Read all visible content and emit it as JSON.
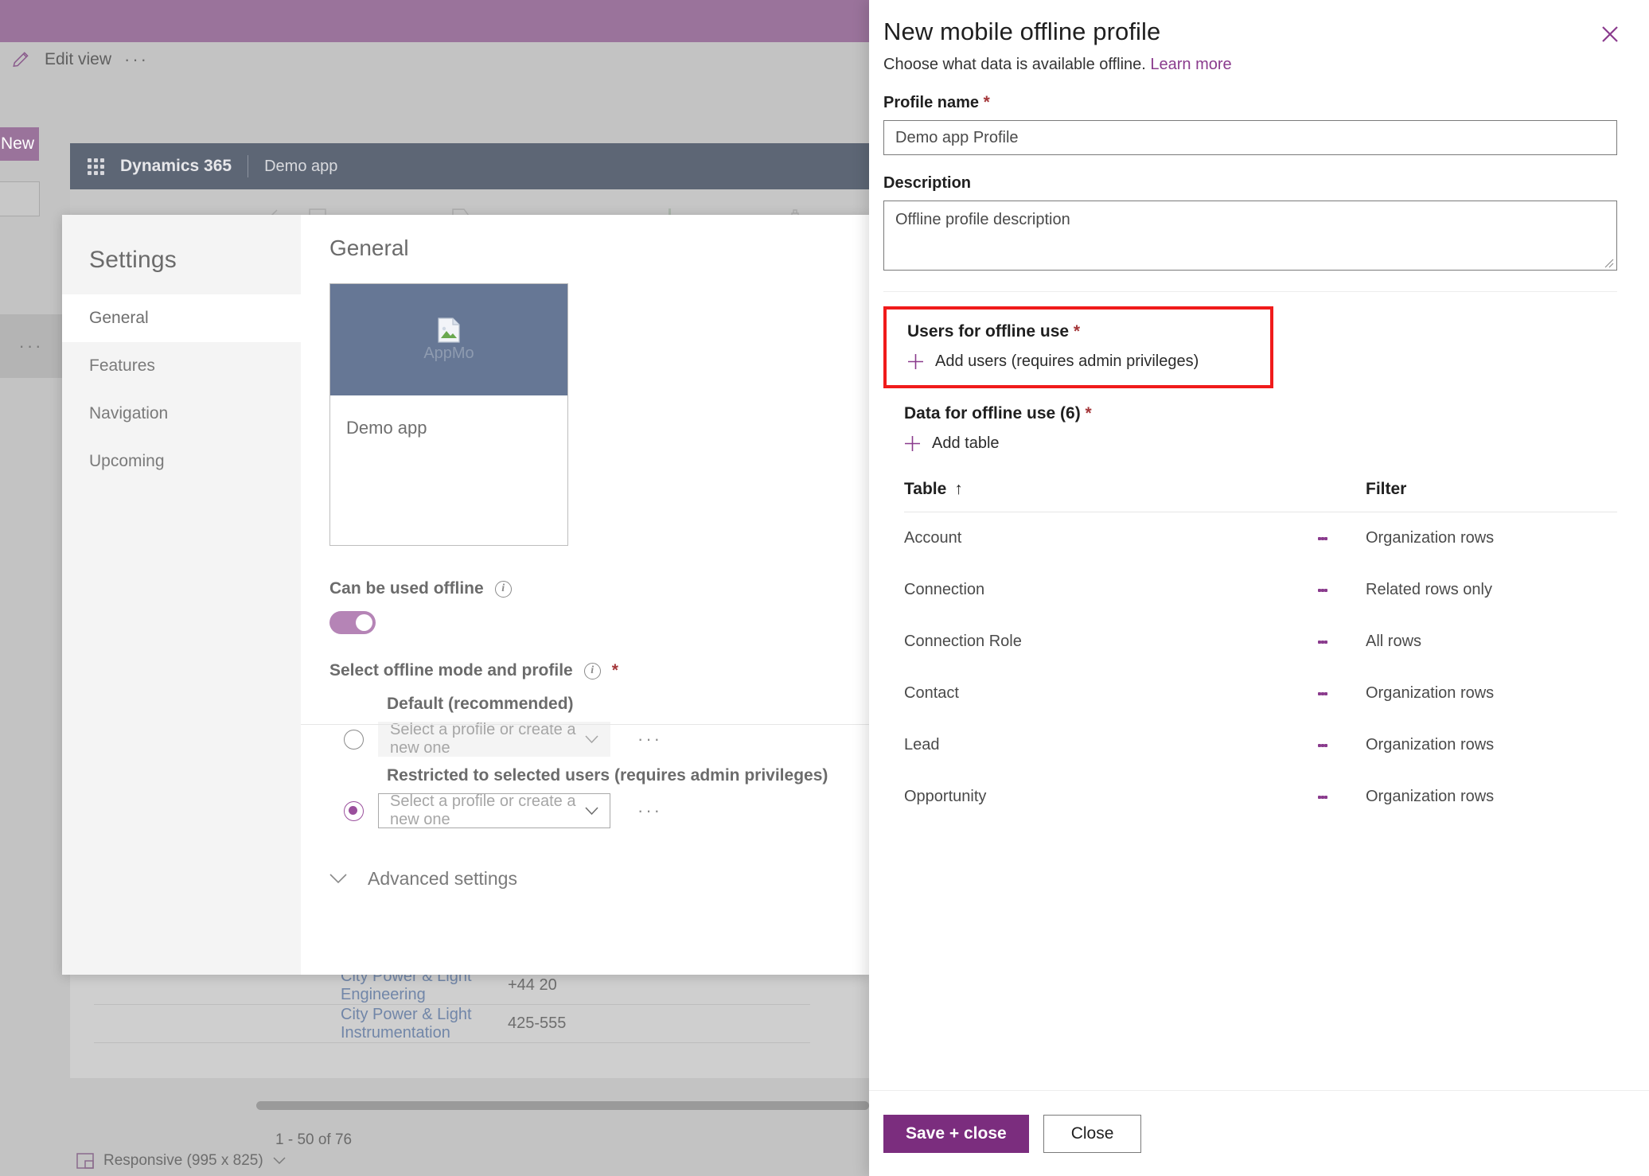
{
  "background": {
    "toolbar": {
      "edit_view_label": "Edit view",
      "overflow_label": "···",
      "new_button_label": "New"
    },
    "app_header": {
      "product_name": "Dynamics 365",
      "app_name": "Demo app"
    },
    "grid_rows": [
      {
        "name": "City Power & Light Engineering",
        "phone": "+44 20"
      },
      {
        "name": "City Power & Light Instrumentation",
        "phone": "425-555"
      }
    ],
    "pager_text": "1 - 50 of 76",
    "responsive_label": "Responsive (995 x 825)"
  },
  "settings_dialog": {
    "nav_title": "Settings",
    "nav_items": [
      {
        "label": "General",
        "active": true
      },
      {
        "label": "Features",
        "active": false
      },
      {
        "label": "Navigation",
        "active": false
      },
      {
        "label": "Upcoming",
        "active": false
      }
    ],
    "main_heading": "General",
    "app_tile": {
      "image_alt": "AppMo",
      "app_name": "Demo app"
    },
    "offline_toggle": {
      "label": "Can be used offline",
      "state_on": true
    },
    "offline_mode": {
      "label": "Select offline mode and profile",
      "required_marker": "*",
      "options": [
        {
          "caption": "Default (recommended)",
          "select_value": "Select a profile or create a new one",
          "selected": false,
          "disabled": true
        },
        {
          "caption": "Restricted to selected users (requires admin privileges)",
          "select_value": "Select a profile or create a new one",
          "selected": true,
          "disabled": false
        }
      ]
    },
    "advanced_settings_label": "Advanced settings"
  },
  "panel": {
    "title": "New mobile offline profile",
    "subtitle_text": "Choose what data is available offline.",
    "learn_more_label": "Learn more",
    "profile_name": {
      "label": "Profile name",
      "required_marker": "*",
      "value": "Demo app Profile"
    },
    "description": {
      "label": "Description",
      "value": "Offline profile description"
    },
    "users_section": {
      "title": "Users for offline use",
      "required_marker": "*",
      "add_label": "Add users (requires admin privileges)",
      "highlight_color": "#f01b1b"
    },
    "data_section": {
      "title": "Data for offline use (6)",
      "required_marker": "*",
      "add_label": "Add table",
      "columns": [
        "Table",
        "Filter"
      ],
      "sort_indicator": "↑",
      "rows": [
        {
          "table": "Account",
          "filter": "Organization rows"
        },
        {
          "table": "Connection",
          "filter": "Related rows only"
        },
        {
          "table": "Connection Role",
          "filter": "All rows"
        },
        {
          "table": "Contact",
          "filter": "Organization rows"
        },
        {
          "table": "Lead",
          "filter": "Organization rows"
        },
        {
          "table": "Opportunity",
          "filter": "Organization rows"
        }
      ]
    },
    "footer": {
      "save_label": "Save + close",
      "close_label": "Close"
    }
  },
  "colors": {
    "brand_purple": "#7b2d7e",
    "accent_purple": "#8a3b8d",
    "header_slate": "#5d6675",
    "highlight_red": "#f01b1b",
    "required_red": "#a4373a"
  }
}
